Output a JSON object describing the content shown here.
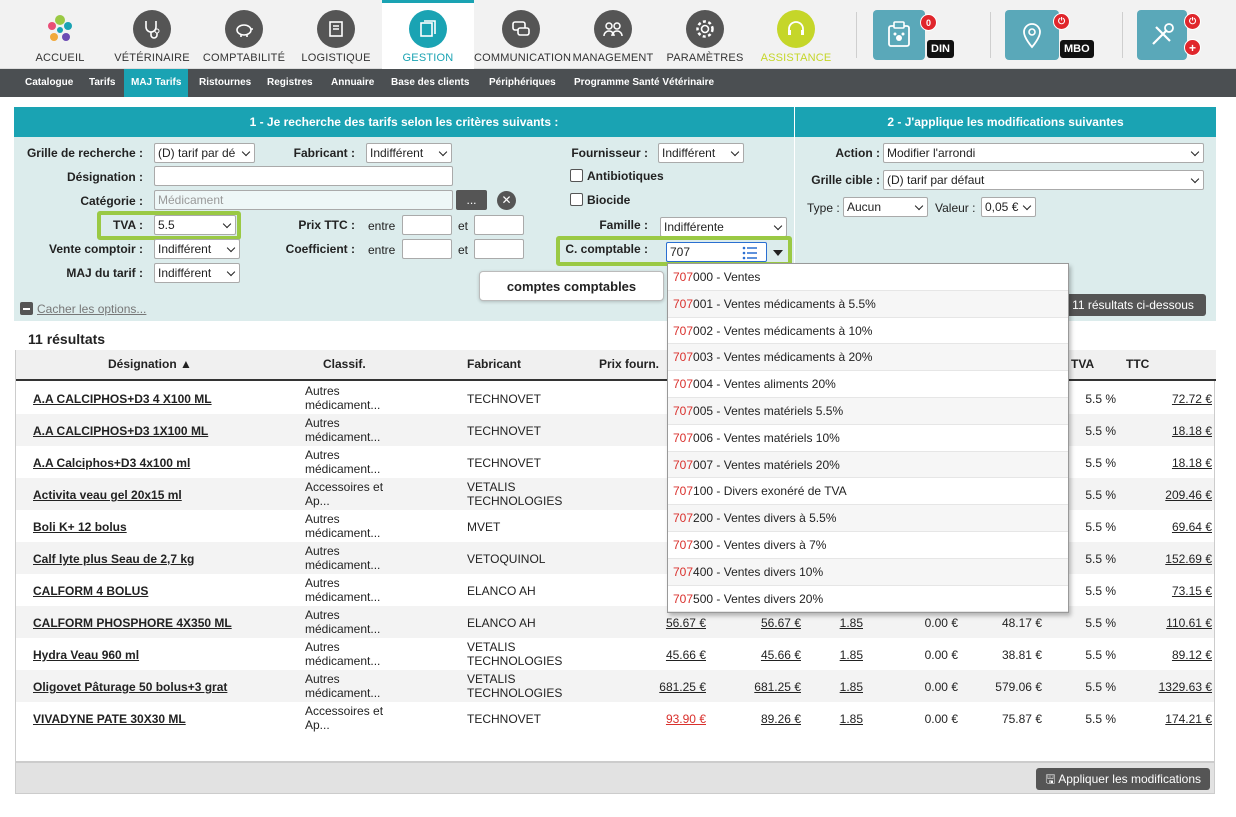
{
  "nav": {
    "items": [
      {
        "label": "ACCUEIL",
        "icon": "logo-icon"
      },
      {
        "label": "VÉTÉRINAIRE",
        "icon": "stethoscope-icon"
      },
      {
        "label": "COMPTABILITÉ",
        "icon": "piggybank-icon"
      },
      {
        "label": "LOGISTIQUE",
        "icon": "box-icon"
      },
      {
        "label": "GESTION",
        "icon": "documents-icon"
      },
      {
        "label": "COMMUNICATION",
        "icon": "chat-icon"
      },
      {
        "label": "MANAGEMENT",
        "icon": "people-icon"
      },
      {
        "label": "PARAMÈTRES",
        "icon": "gear-icon"
      },
      {
        "label": "ASSISTANCE",
        "icon": "headset-icon"
      }
    ],
    "din_badge": "DIN",
    "din_count": "0",
    "mbo_badge": "MBO"
  },
  "subnav": [
    "Catalogue",
    "Tarifs",
    "MAJ Tarifs",
    "Ristournes",
    "Registres",
    "Annuaire",
    "Base des clients",
    "Périphériques",
    "Programme Santé Vétérinaire"
  ],
  "left_panel": {
    "title": "1 - Je recherche des tarifs selon les critères suivants :",
    "grille_label": "Grille de recherche :",
    "grille_value": "(D) tarif par dé",
    "fabricant_label": "Fabricant :",
    "fabricant_value": "Indifférent",
    "fournisseur_label": "Fournisseur :",
    "fournisseur_value": "Indifférent",
    "designation_label": "Désignation :",
    "antibiotiques_label": "Antibiotiques",
    "categorie_label": "Catégorie :",
    "categorie_placeholder": "Médicament",
    "categorie_btn": "...",
    "biocide_label": "Biocide",
    "tva_label": "TVA :",
    "tva_value": "5.5",
    "prixttc_label": "Prix TTC :",
    "entre": "entre",
    "et": "et",
    "famille_label": "Famille :",
    "famille_value": "Indifférente",
    "vente_label": "Vente comptoir :",
    "vente_value": "Indifférent",
    "coef_label": "Coefficient :",
    "ccomptable_label": "C. comptable :",
    "ccomptable_value": "707",
    "maj_label": "MAJ du tarif :",
    "maj_value": "Indifférent",
    "cacher": "Cacher les options..."
  },
  "right_panel": {
    "title": "2 - J'applique les modifications suivantes",
    "action_label": "Action :",
    "action_value": "Modifier l'arrondi",
    "grille_cible_label": "Grille cible :",
    "grille_cible_value": "(D) tarif par défaut",
    "type_label": "Type :",
    "type_value": "Aucun",
    "valeur_label": "Valeur :",
    "valeur_value": "0,05 €",
    "results_btn": "11 résultats ci-dessous"
  },
  "tooltip": "comptes comptables",
  "results": {
    "count": "11 résultats",
    "headers": {
      "designation": "Désignation ▲",
      "classif": "Classif.",
      "fabricant": "Fabricant",
      "prix_fourn": "Prix fourn.",
      "tva": "TVA",
      "ttc": "TTC"
    },
    "rows": [
      {
        "name": "A.A CALCIPHOS+D3 4 X100 ML",
        "classif": [
          "Autres",
          "médicament..."
        ],
        "fab": [
          "TECHNOVET"
        ],
        "pf": "",
        "pf2": "",
        "coef": "",
        "rem": "",
        "ht": "",
        "tva": "5.5 %",
        "ttc": "72.72 €"
      },
      {
        "name": "A.A CALCIPHOS+D3 1X100 ML",
        "classif": [
          "Autres",
          "médicament..."
        ],
        "fab": [
          "TECHNOVET"
        ],
        "pf": "",
        "pf2": "",
        "coef": "",
        "rem": "",
        "ht": "",
        "tva": "5.5 %",
        "ttc": "18.18 €"
      },
      {
        "name": "A.A Calciphos+D3 4x100 ml",
        "classif": [
          "Autres",
          "médicament..."
        ],
        "fab": [
          "TECHNOVET"
        ],
        "pf": "",
        "pf2": "",
        "coef": "",
        "rem": "",
        "ht": "",
        "tva": "5.5 %",
        "ttc": "18.18 €"
      },
      {
        "name": "Activita veau gel 20x15 ml",
        "classif": [
          "Accessoires et",
          "Ap..."
        ],
        "fab": [
          "VETALIS",
          "TECHNOLOGIES"
        ],
        "pf": "",
        "pf2": "",
        "coef": "",
        "rem": "",
        "ht": "",
        "tva": "5.5 %",
        "ttc": "209.46 €"
      },
      {
        "name": "Boli K+ 12 bolus",
        "classif": [
          "Autres",
          "médicament..."
        ],
        "fab": [
          "MVET"
        ],
        "pf": "",
        "pf2": "",
        "coef": "",
        "rem": "",
        "ht": "",
        "tva": "5.5 %",
        "ttc": "69.64 €"
      },
      {
        "name": "Calf lyte plus Seau de 2,7 kg",
        "classif": [
          "Autres",
          "médicament..."
        ],
        "fab": [
          "VETOQUINOL"
        ],
        "pf": "",
        "pf2": "",
        "coef": "",
        "rem": "",
        "ht": "",
        "tva": "5.5 %",
        "ttc": "152.69 €"
      },
      {
        "name": "CALFORM 4 BOLUS",
        "classif": [
          "Autres",
          "médicament..."
        ],
        "fab": [
          "ELANCO AH"
        ],
        "pf": "",
        "pf2": "",
        "coef": "",
        "rem": "",
        "ht": "",
        "tva": "5.5 %",
        "ttc": "73.15 €"
      },
      {
        "name": "CALFORM PHOSPHORE 4X350 ML",
        "classif": [
          "Autres",
          "médicament..."
        ],
        "fab": [
          "ELANCO AH"
        ],
        "pf": "56.67 €",
        "pf2": "56.67 €",
        "coef": "1.85",
        "rem": "0.00 €",
        "ht": "48.17 €",
        "tva": "5.5 %",
        "ttc": "110.61 €"
      },
      {
        "name": "Hydra Veau 960 ml",
        "classif": [
          "Autres",
          "médicament..."
        ],
        "fab": [
          "VETALIS",
          "TECHNOLOGIES"
        ],
        "pf": "45.66 €",
        "pf2": "45.66 €",
        "coef": "1.85",
        "rem": "0.00 €",
        "ht": "38.81 €",
        "tva": "5.5 %",
        "ttc": "89.12 €"
      },
      {
        "name": "Oligovet Pâturage 50 bolus+3 grat",
        "classif": [
          "Autres",
          "médicament..."
        ],
        "fab": [
          "VETALIS",
          "TECHNOLOGIES"
        ],
        "pf": "681.25 €",
        "pf2": "681.25 €",
        "coef": "1.85",
        "rem": "0.00 €",
        "ht": "579.06 €",
        "tva": "5.5 %",
        "ttc": "1329.63 €"
      },
      {
        "name": "VIVADYNE PATE 30X30 ML",
        "classif": [
          "Accessoires et",
          "Ap..."
        ],
        "fab": [
          "TECHNOVET"
        ],
        "pf": "93.90 €",
        "pf2": "89.26 €",
        "coef": "1.85",
        "rem": "0.00 €",
        "ht": "75.87 €",
        "tva": "5.5 %",
        "ttc": "174.21 €"
      }
    ],
    "apply_btn": "Appliquer les modifications"
  },
  "dropdown": {
    "prefix": "707",
    "options": [
      {
        "code": "000",
        "text": " - Ventes"
      },
      {
        "code": "001",
        "text": " - Ventes médicaments à 5.5%"
      },
      {
        "code": "002",
        "text": " - Ventes médicaments à 10%"
      },
      {
        "code": "003",
        "text": " - Ventes médicaments à 20%"
      },
      {
        "code": "004",
        "text": " - Ventes aliments 20%"
      },
      {
        "code": "005",
        "text": " - Ventes matériels 5.5%"
      },
      {
        "code": "006",
        "text": " - Ventes matériels 10%"
      },
      {
        "code": "007",
        "text": " - Ventes matériels 20%"
      },
      {
        "code": "100",
        "text": " - Divers exonéré de TVA"
      },
      {
        "code": "200",
        "text": " - Ventes divers à 5.5%"
      },
      {
        "code": "300",
        "text": " - Ventes divers à 7%"
      },
      {
        "code": "400",
        "text": " - Ventes divers 10%"
      },
      {
        "code": "500",
        "text": " - Ventes divers 20%"
      }
    ]
  },
  "colors": {
    "accent": "#1aa3b3",
    "highlight": "#9ac944",
    "red": "#d9302c"
  }
}
